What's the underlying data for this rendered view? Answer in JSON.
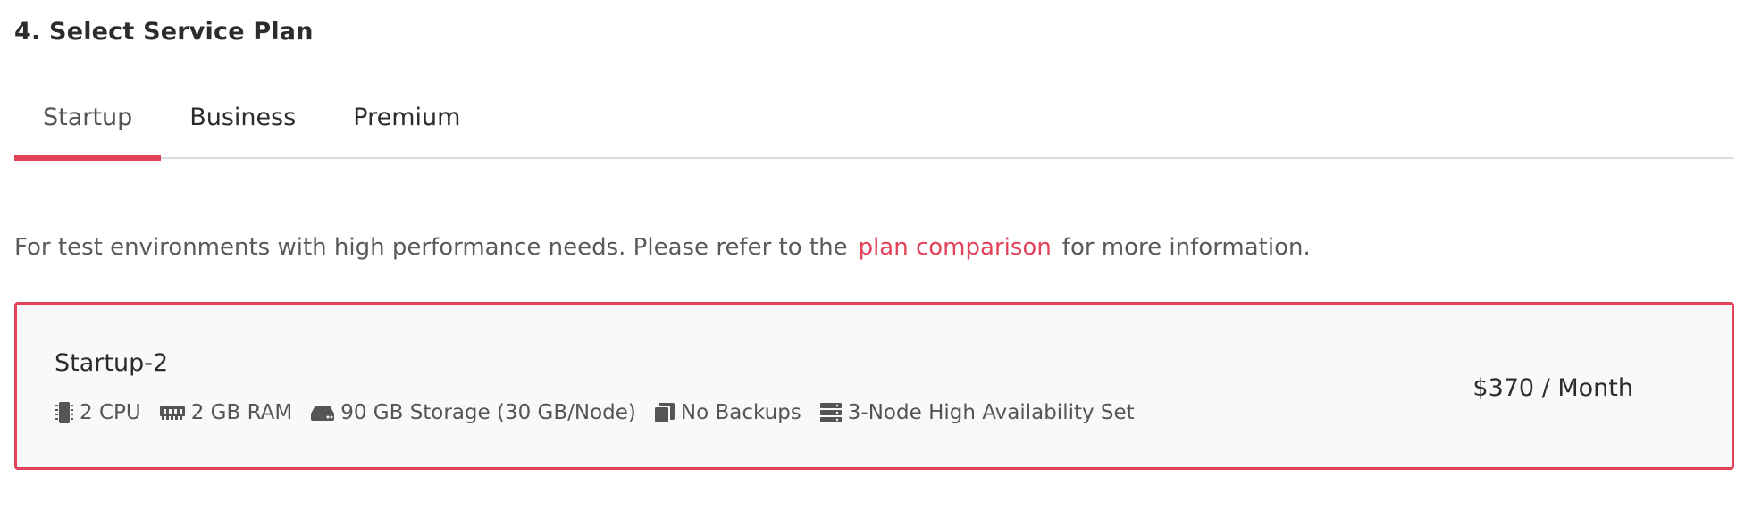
{
  "section": {
    "title": "4. Select Service Plan"
  },
  "tabs": [
    {
      "label": "Startup",
      "active": true
    },
    {
      "label": "Business",
      "active": false
    },
    {
      "label": "Premium",
      "active": false
    }
  ],
  "description": {
    "before": "For test environments with high performance needs. Please refer to the",
    "link": "plan comparison",
    "after": "for more information."
  },
  "plan": {
    "name": "Startup-2",
    "price": "$370 / Month",
    "specs": [
      {
        "icon": "cpu-icon",
        "label": "2 CPU"
      },
      {
        "icon": "ram-icon",
        "label": "2 GB RAM"
      },
      {
        "icon": "storage-icon",
        "label": "90 GB Storage (30 GB/Node)"
      },
      {
        "icon": "backup-icon",
        "label": "No Backups"
      },
      {
        "icon": "server-icon",
        "label": "3-Node High Availability Set"
      }
    ]
  },
  "colors": {
    "accent": "#e2435a",
    "card_bg": "#f9f9f9",
    "divider": "#dcdcdc"
  }
}
